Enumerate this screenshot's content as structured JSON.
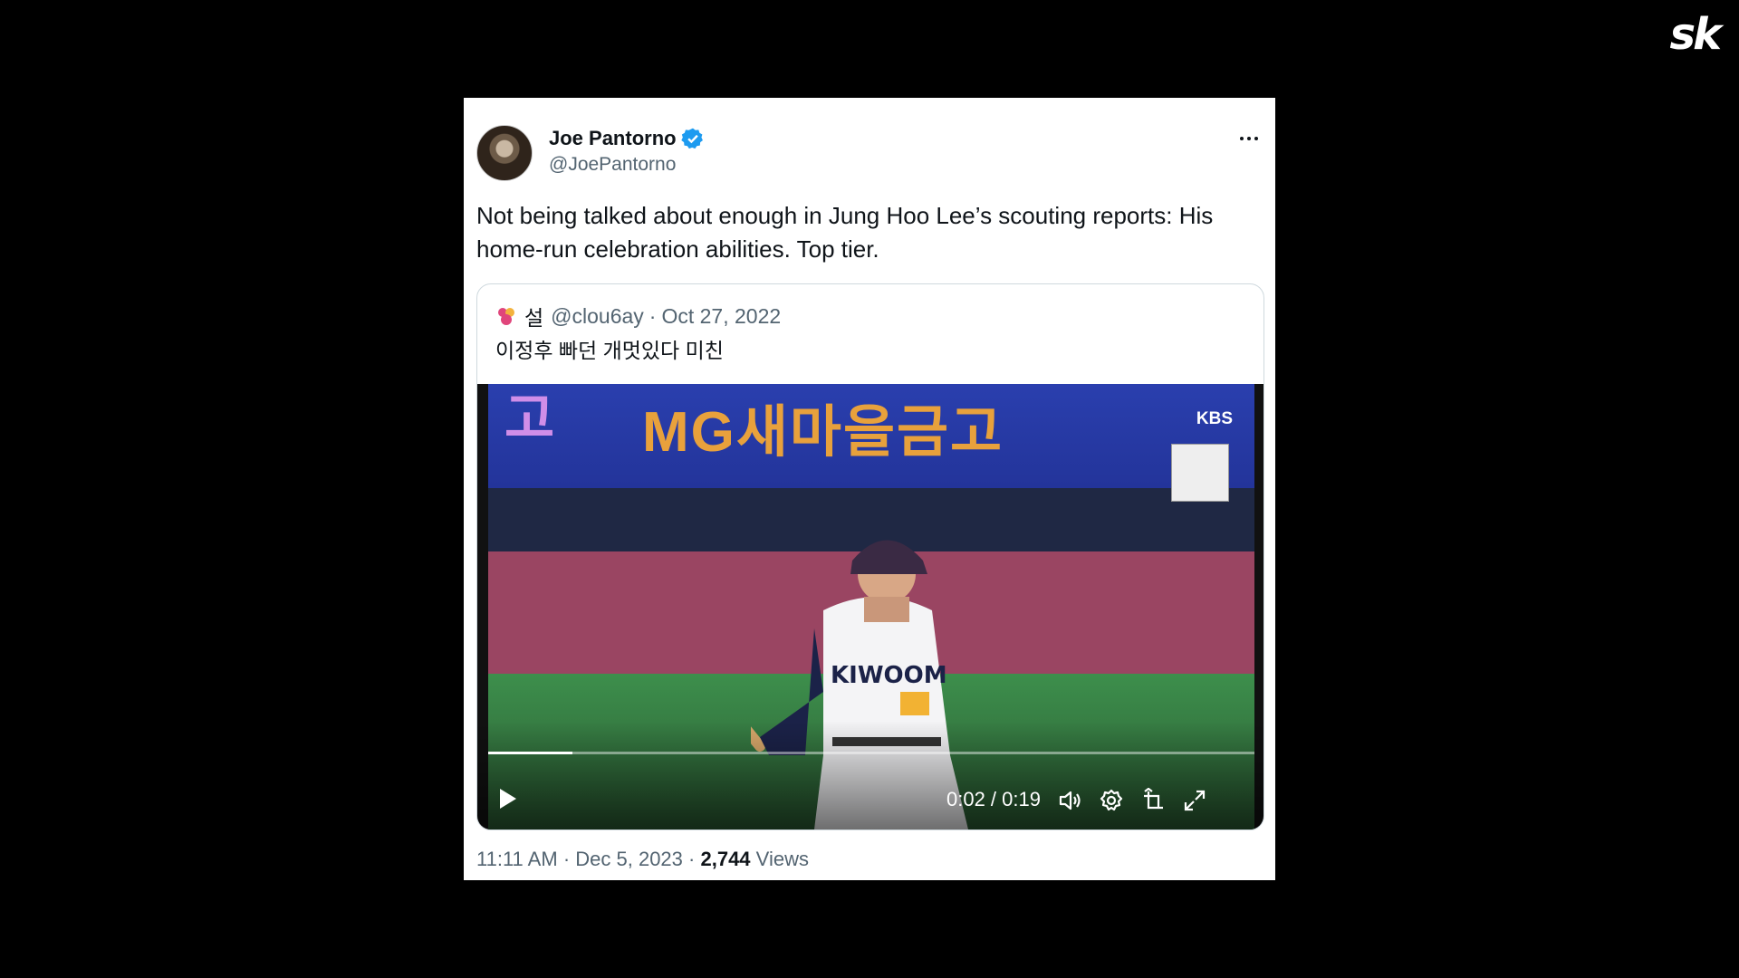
{
  "logo": {
    "text": "sk"
  },
  "tweet": {
    "author_name": "Joe Pantorno",
    "author_handle": "@JoePantorno",
    "text": "Not being talked about enough in Jung Hoo Lee’s scouting reports: His home-run celebration abilities. Top tier.",
    "verified_color": "#1d9bf0",
    "time": "11:11 AM",
    "date": "Dec 5, 2023",
    "separator": "·",
    "views_count": "2,744",
    "views_label": "Views"
  },
  "quote": {
    "name": "설",
    "handle": "@clou6ay",
    "separator": "·",
    "date": "Oct 27, 2022",
    "text": "이정후 빠던 개멋있다 미친"
  },
  "video": {
    "current_time": "0:02 / 0:19",
    "progress_fraction": 0.11,
    "broadcaster": "KBS",
    "icons": [
      "play-icon",
      "volume-icon",
      "settings-icon",
      "pip-icon",
      "fullscreen-icon"
    ]
  }
}
